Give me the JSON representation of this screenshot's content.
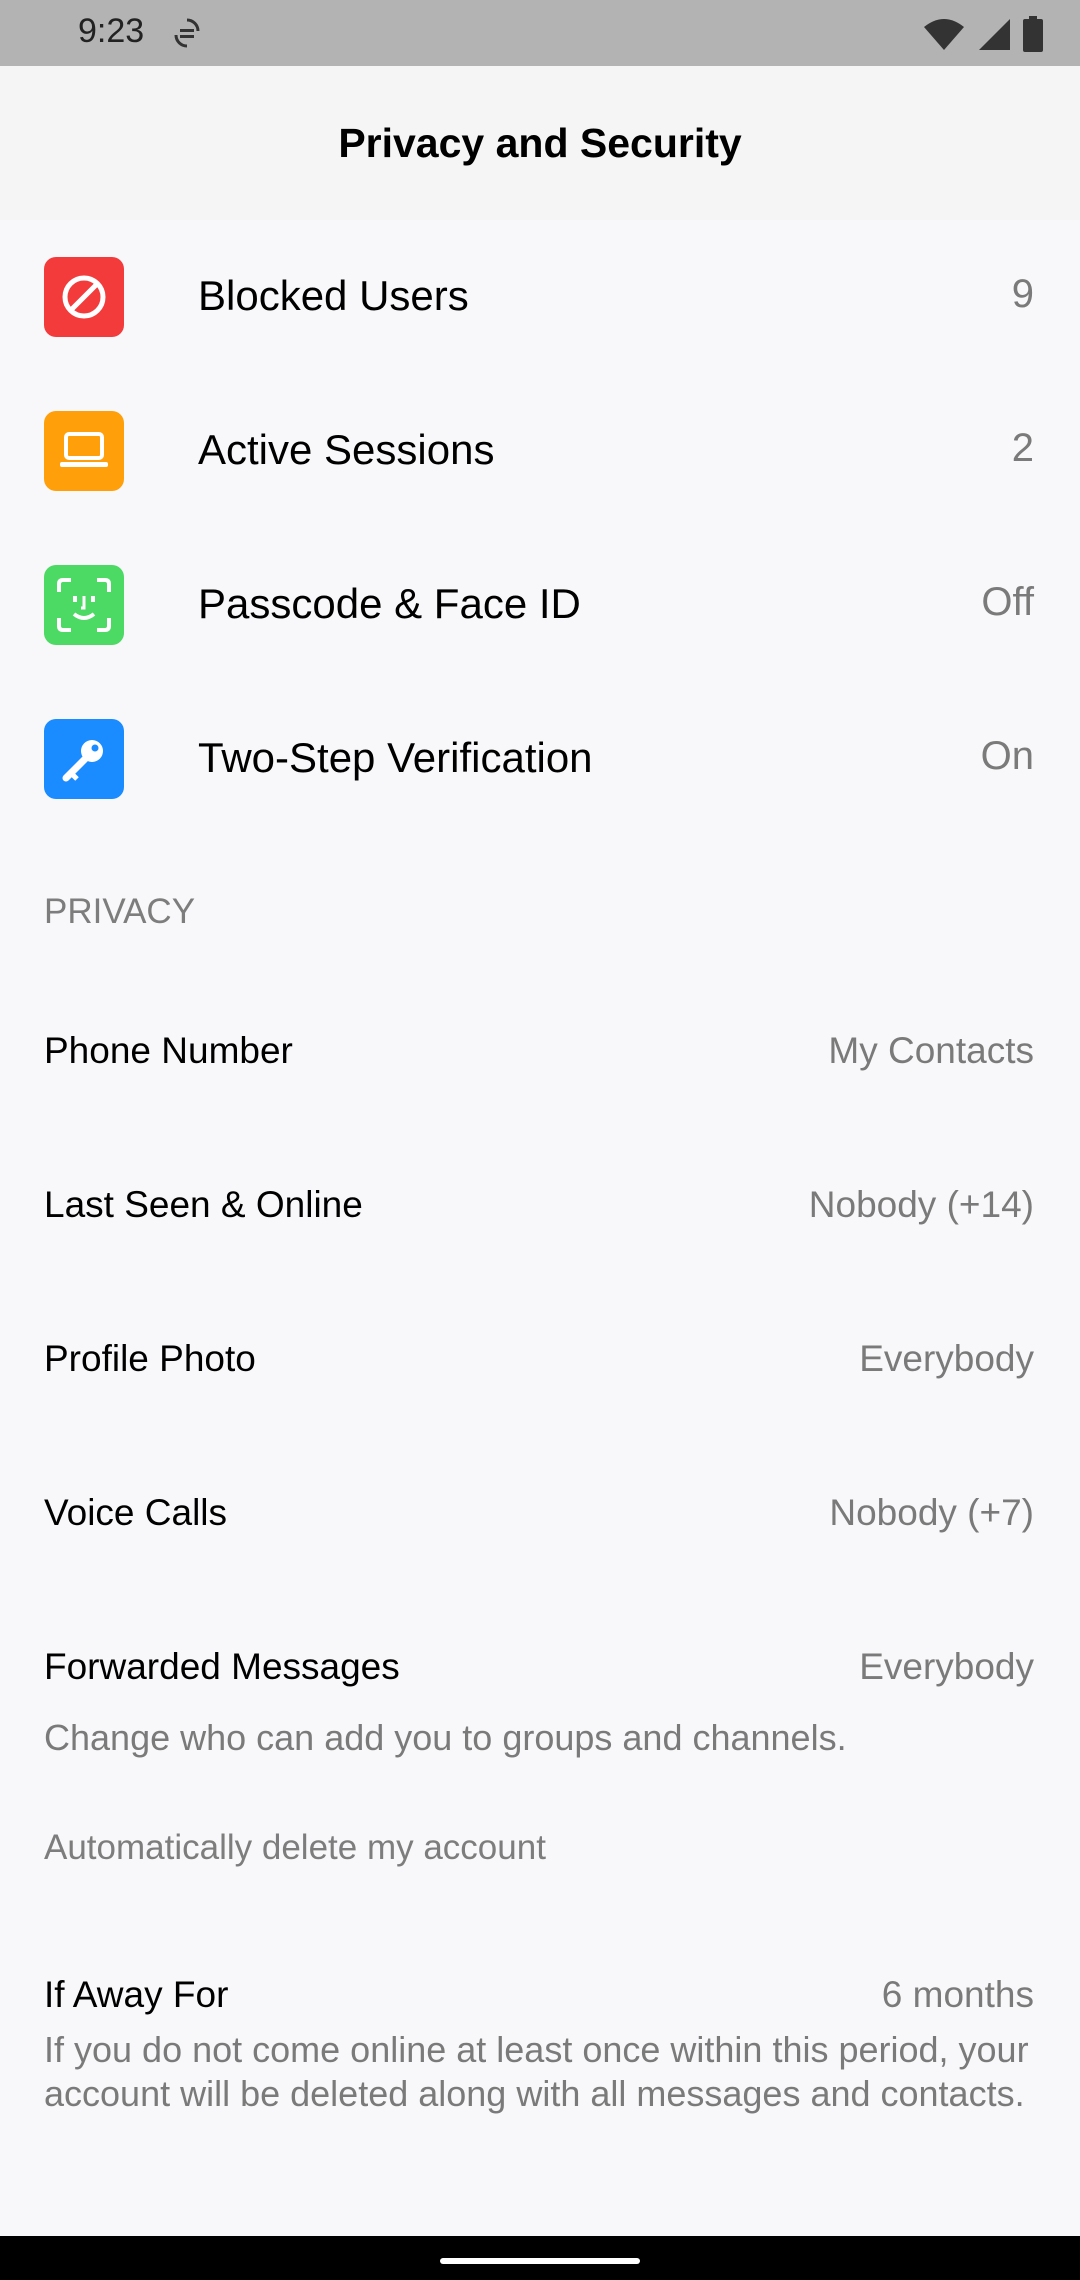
{
  "status_bar": {
    "time": "9:23",
    "icons": [
      "sync-icon",
      "wifi-icon",
      "cellular-signal-icon",
      "battery-icon"
    ]
  },
  "header": {
    "title": "Privacy and Security"
  },
  "security_items": [
    {
      "label": "Blocked Users",
      "value": "9",
      "icon": "blocked-icon",
      "color": "#f43b3b"
    },
    {
      "label": "Active Sessions",
      "value": "2",
      "icon": "laptop-icon",
      "color": "#ff9f0a"
    },
    {
      "label": "Passcode & Face ID",
      "value": "Off",
      "icon": "face-id-icon",
      "color": "#4cd964"
    },
    {
      "label": "Two-Step Verification",
      "value": "On",
      "icon": "key-icon",
      "color": "#1a8cff"
    }
  ],
  "privacy": {
    "section_title": "PRIVACY",
    "items": [
      {
        "label": "Phone Number",
        "value": "My Contacts"
      },
      {
        "label": "Last Seen & Online",
        "value": "Nobody (+14)"
      },
      {
        "label": "Profile Photo",
        "value": "Everybody"
      },
      {
        "label": "Voice Calls",
        "value": "Nobody (+7)"
      },
      {
        "label": "Forwarded Messages",
        "value": "Everybody"
      }
    ],
    "footer_note": "Change who can add you to groups and channels."
  },
  "delete_account": {
    "section_title": "Automatically delete my account",
    "item": {
      "label": "If Away For",
      "value": "6 months"
    },
    "note": "If you do not come online at least once within this period, your account will be deleted along with all messages and contacts."
  }
}
